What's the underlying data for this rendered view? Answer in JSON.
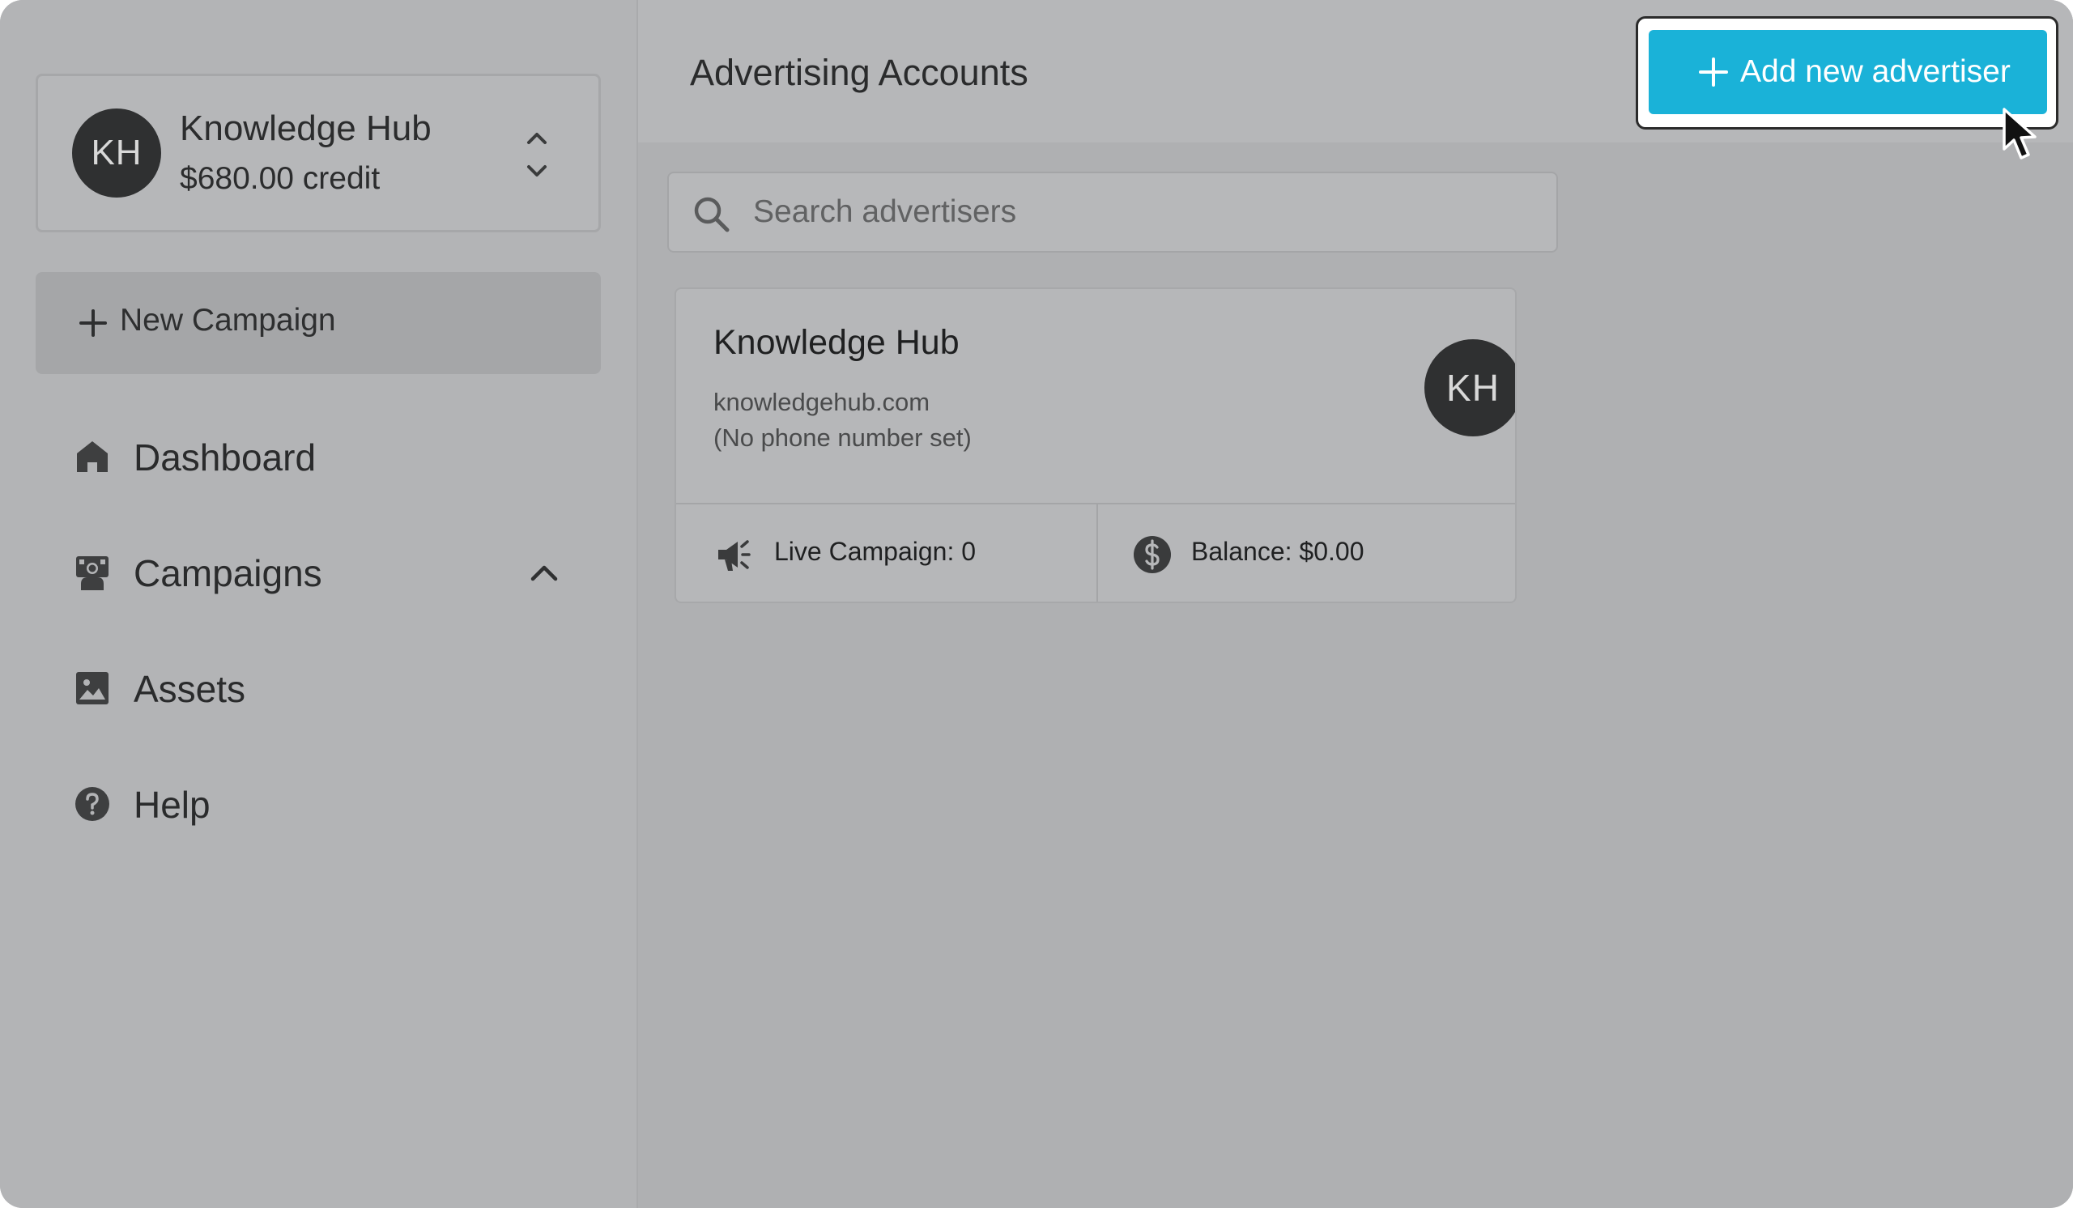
{
  "sidebar": {
    "account": {
      "initials": "KH",
      "name": "Knowledge Hub",
      "credit": "$680.00 credit"
    },
    "new_campaign_label": "New Campaign",
    "nav": [
      {
        "label": "Dashboard",
        "icon": "home-icon"
      },
      {
        "label": "Campaigns",
        "icon": "campaigns-icon",
        "expanded": true
      },
      {
        "label": "Assets",
        "icon": "image-icon"
      },
      {
        "label": "Help",
        "icon": "help-icon"
      }
    ]
  },
  "header": {
    "title": "Advertising Accounts",
    "add_button_label": "Add new advertiser"
  },
  "search": {
    "placeholder": "Search advertisers",
    "value": ""
  },
  "advertisers": [
    {
      "name": "Knowledge Hub",
      "domain": "knowledgehub.com",
      "phone": "(No phone number set)",
      "initials": "KH",
      "live_campaign": "Live Campaign: 0",
      "balance": "Balance: $0.00"
    }
  ],
  "colors": {
    "accent": "#1ab2d8",
    "avatar_bg": "#2f3031"
  }
}
